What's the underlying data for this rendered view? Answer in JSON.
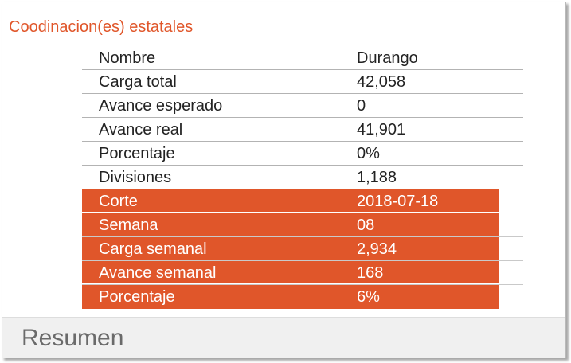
{
  "panel": {
    "title": "Coodinacion(es) estatales",
    "footer_label": "Resumen"
  },
  "colors": {
    "accent": "#e0562a",
    "footer_bg": "#f0f0f0",
    "footer_text": "#6a6a6a"
  },
  "table": {
    "rows": [
      {
        "name": "Nombre",
        "value": "Durango",
        "highlighted": false
      },
      {
        "name": "Carga total",
        "value": "42,058",
        "highlighted": false
      },
      {
        "name": "Avance esperado",
        "value": "0",
        "highlighted": false
      },
      {
        "name": "Avance real",
        "value": "41,901",
        "highlighted": false
      },
      {
        "name": "Porcentaje",
        "value": "0%",
        "highlighted": false
      },
      {
        "name": "Divisiones",
        "value": "1,188",
        "highlighted": false
      },
      {
        "name": "Corte",
        "value": "2018-07-18",
        "highlighted": true
      },
      {
        "name": "Semana",
        "value": "08",
        "highlighted": true
      },
      {
        "name": "Carga semanal",
        "value": "2,934",
        "highlighted": true
      },
      {
        "name": "Avance semanal",
        "value": "168",
        "highlighted": true
      },
      {
        "name": "Porcentaje",
        "value": "6%",
        "highlighted": true
      }
    ]
  }
}
